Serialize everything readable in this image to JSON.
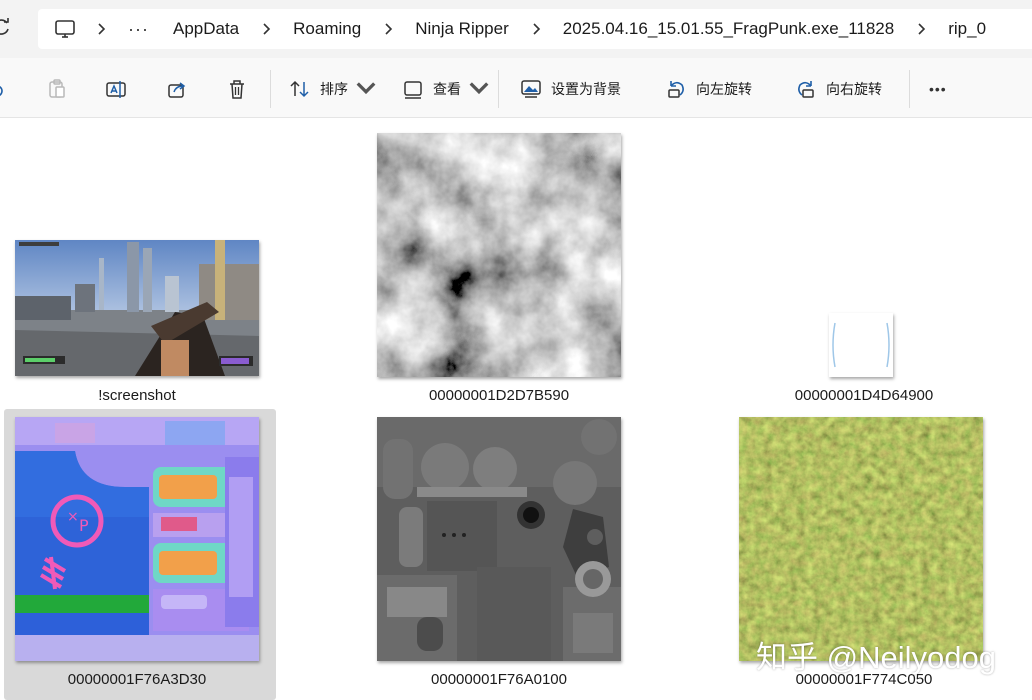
{
  "address_bar": {
    "overflow_label": "···",
    "crumbs": [
      "AppData",
      "Roaming",
      "Ninja Ripper",
      "2025.04.16_15.01.55_FragPunk.exe_11828",
      "rip_0"
    ]
  },
  "toolbar": {
    "sort_label": "排序",
    "view_label": "查看",
    "set_background_label": "设置为背景",
    "rotate_left_label": "向左旋转",
    "rotate_right_label": "向右旋转",
    "more_label": "•••"
  },
  "files": [
    {
      "name": "!screenshot"
    },
    {
      "name": "00000001D2D7B590"
    },
    {
      "name": "00000001D4D64900"
    },
    {
      "name": "00000001F76A3D30",
      "selected": true
    },
    {
      "name": "00000001F76A0100"
    },
    {
      "name": "00000001F774C050"
    }
  ],
  "watermark": "知乎 @Neilyodog",
  "colors": {
    "address_bg": "#f3f3f3",
    "toolbar_bg": "#f9f9f9",
    "selection": "#d9d9d9",
    "icon_blue": "#1f5fa8"
  }
}
